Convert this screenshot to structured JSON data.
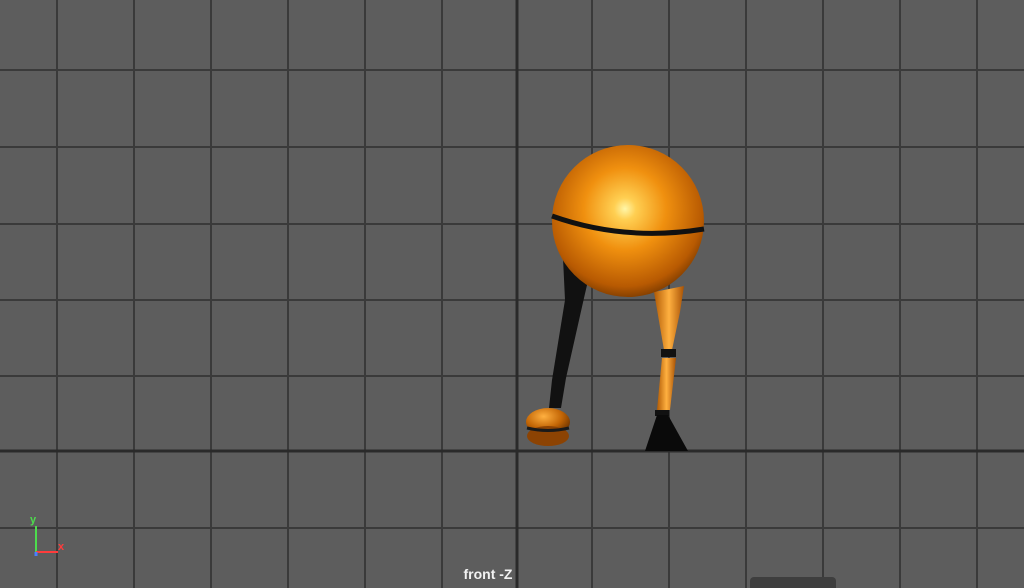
{
  "viewport": {
    "camera_label": "front -Z",
    "background_color": "#5d5d5d",
    "grid_line_color": "#3a3a3a",
    "axis_line_color": "#2a2a2a"
  },
  "axis_gizmo": {
    "y_label": "y",
    "x_label": "x",
    "y_color": "#4ddc4d",
    "x_color": "#ff3c3c",
    "z_color": "#4a7dff"
  },
  "model": {
    "name_icon": "orange-ball-walker-character",
    "body_color": "#e8830e",
    "shadow_color": "#111111"
  }
}
